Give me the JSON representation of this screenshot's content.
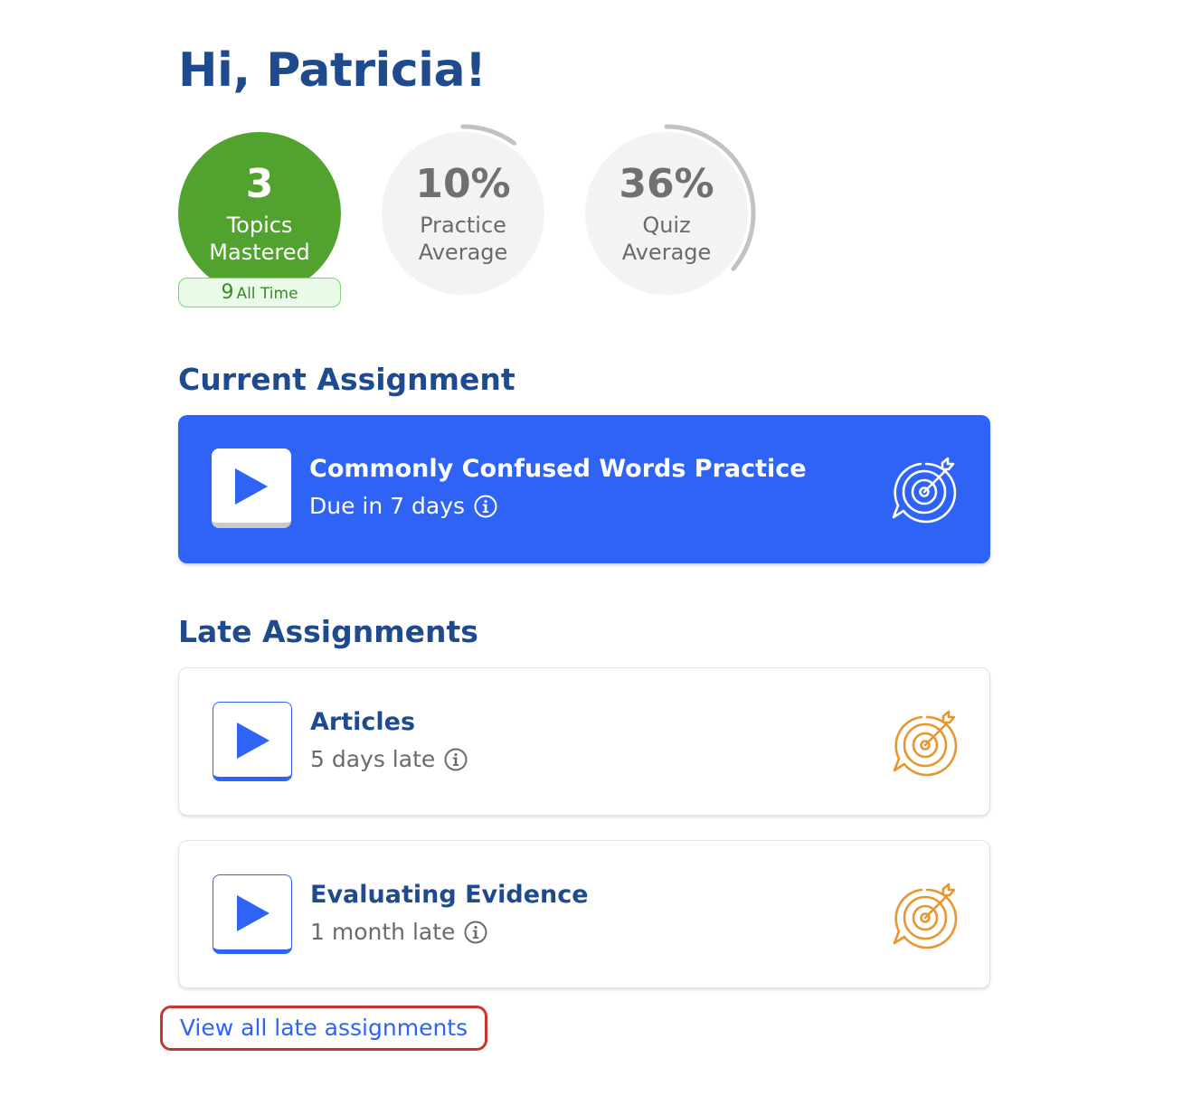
{
  "greeting": "Hi, Patricia!",
  "stats": {
    "mastered": {
      "value": "3",
      "label_line1": "Topics",
      "label_line2": "Mastered",
      "all_time_count": "9",
      "all_time_label": "All Time",
      "color": "#52a22f"
    },
    "practice": {
      "value": "10%",
      "label_line1": "Practice",
      "label_line2": "Average",
      "progress_fraction": 0.1
    },
    "quiz": {
      "value": "36%",
      "label_line1": "Quiz",
      "label_line2": "Average",
      "progress_fraction": 0.36
    },
    "ring_color": "#c2c2c2"
  },
  "current_section": {
    "heading": "Current Assignment",
    "assignment": {
      "title": "Commonly Confused Words Practice",
      "due": "Due in 7 days",
      "icon": "target-icon",
      "background": "#2e63f6"
    }
  },
  "late_section": {
    "heading": "Late Assignments",
    "assignments": [
      {
        "title": "Articles",
        "status": "5 days late",
        "icon": "target-icon",
        "icon_color": "#e8962f"
      },
      {
        "title": "Evaluating Evidence",
        "status": "1 month late",
        "icon": "target-icon",
        "icon_color": "#e8962f"
      }
    ],
    "view_all_label": "View all late assignments"
  },
  "colors": {
    "heading": "#1f4b8e",
    "accent": "#2e63f6",
    "highlight_border": "#c8372d"
  }
}
